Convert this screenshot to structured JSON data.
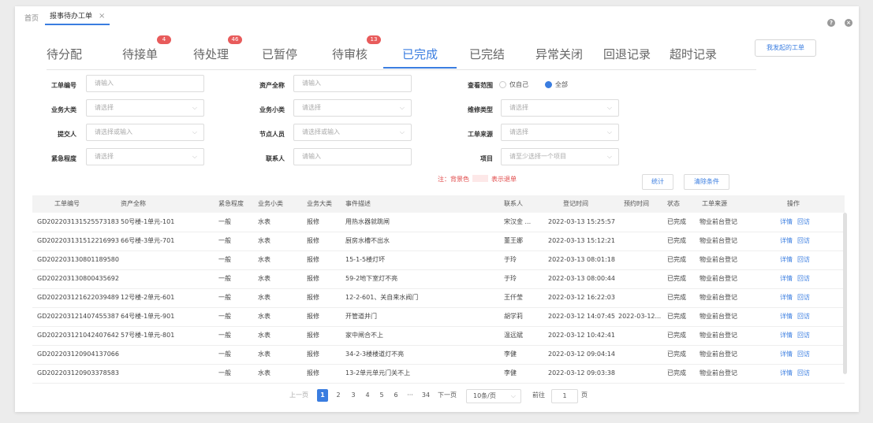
{
  "tabs": {
    "home": "首页",
    "active": "报事待办工单",
    "close": "×"
  },
  "top_icons": [
    "help-icon",
    "close-circle-icon"
  ],
  "top_icon_glyphs": {
    "help": "?",
    "close": "×"
  },
  "status_tabs": [
    {
      "label": "待分配",
      "badge": ""
    },
    {
      "label": "待接单",
      "badge": "4"
    },
    {
      "label": "待处理",
      "badge": "46"
    },
    {
      "label": "已暂停",
      "badge": ""
    },
    {
      "label": "待审核",
      "badge": "13"
    },
    {
      "label": "已完成",
      "badge": "",
      "active": true
    },
    {
      "label": "已完结",
      "badge": ""
    },
    {
      "label": "异常关闭",
      "badge": ""
    },
    {
      "label": "回退记录",
      "badge": ""
    },
    {
      "label": "超时记录",
      "badge": ""
    }
  ],
  "my_orders_button": "我发起的工单",
  "form": {
    "order_no": {
      "label": "工单编号",
      "placeholder": "请输入"
    },
    "asset_name": {
      "label": "资产全称",
      "placeholder": "请输入"
    },
    "scope": {
      "label": "查看范围",
      "options": [
        "仅自己",
        "全部"
      ],
      "selected": "全部"
    },
    "biz_major": {
      "label": "业务大类",
      "placeholder": "请选择"
    },
    "biz_minor": {
      "label": "业务小类",
      "placeholder": "请选择"
    },
    "repair_type": {
      "label": "维修类型",
      "placeholder": "请选择"
    },
    "submitter": {
      "label": "提交人",
      "placeholder": "请选择或输入"
    },
    "node_person": {
      "label": "节点人员",
      "placeholder": "请选择或输入"
    },
    "order_source": {
      "label": "工单来源",
      "placeholder": "请选择"
    },
    "urgency": {
      "label": "紧急程度",
      "placeholder": "请选择"
    },
    "contact": {
      "label": "联系人",
      "placeholder": "请输入"
    },
    "project": {
      "label": "项目",
      "placeholder": "请至少选择一个项目"
    },
    "note_prefix": "注：背景色",
    "note_suffix": "表示退单",
    "stats_button": "统计",
    "clear_button": "清除条件"
  },
  "table": {
    "headers": [
      "工单编号",
      "资产全称",
      "紧急程度",
      "业务小类",
      "业务大类",
      "事件描述",
      "联系人",
      "登记时间",
      "预约时间",
      "状态",
      "工单来源",
      "操作"
    ],
    "rows": [
      [
        "GD202203131525573183",
        "50号楼-1单元-101",
        "一般",
        "水表",
        "报修",
        "用热水器就跳闸",
        "宋汉金 ...",
        "2022-03-13 15:25:57",
        "",
        "已完成",
        "物业前台登记"
      ],
      [
        "GD202203131512216993",
        "66号楼-3单元-701",
        "一般",
        "水表",
        "报修",
        "厨房水槽不出水",
        "董王娜",
        "2022-03-13 15:12:21",
        "",
        "已完成",
        "物业前台登记"
      ],
      [
        "GD202203130801189580",
        "",
        "一般",
        "水表",
        "报修",
        "15-1-5楼灯坏",
        "于玲",
        "2022-03-13 08:01:18",
        "",
        "已完成",
        "物业前台登记"
      ],
      [
        "GD202203130800435692",
        "",
        "一般",
        "水表",
        "报修",
        "59-2地下室灯不亮",
        "于玲",
        "2022-03-13 08:00:44",
        "",
        "已完成",
        "物业前台登记"
      ],
      [
        "GD202203121622039489",
        "12号楼-2单元-601",
        "一般",
        "水表",
        "报修",
        "12-2-601、关自来水阀门",
        "王仟莹",
        "2022-03-12 16:22:03",
        "",
        "已完成",
        "物业前台登记"
      ],
      [
        "GD202203121407455387",
        "64号楼-1单元-901",
        "一般",
        "水表",
        "报修",
        "开管道井门",
        "胡学莉",
        "2022-03-12 14:07:45",
        "2022-03-12...",
        "已完成",
        "物业前台登记"
      ],
      [
        "GD202203121042407642",
        "57号楼-1单元-801",
        "一般",
        "水表",
        "报修",
        "家中闸合不上",
        "温远斌",
        "2022-03-12 10:42:41",
        "",
        "已完成",
        "物业前台登记"
      ],
      [
        "GD202203120904137066",
        "",
        "一般",
        "水表",
        "报修",
        "34-2-3楼楼道灯不亮",
        "李健",
        "2022-03-12 09:04:14",
        "",
        "已完成",
        "物业前台登记"
      ],
      [
        "GD202203120903378583",
        "",
        "一般",
        "水表",
        "报修",
        "13-2单元单元门关不上",
        "李健",
        "2022-03-12 09:03:38",
        "",
        "已完成",
        "物业前台登记"
      ]
    ],
    "action_detail": "详情",
    "action_revisit": "回访"
  },
  "pagination": {
    "prev": "上一页",
    "pages": [
      "1",
      "2",
      "3",
      "4",
      "5",
      "6",
      "···",
      "34"
    ],
    "current": "1",
    "next": "下一页",
    "page_size": "10条/页",
    "goto_label": "前往",
    "goto_value": "1",
    "goto_suffix": "页"
  }
}
